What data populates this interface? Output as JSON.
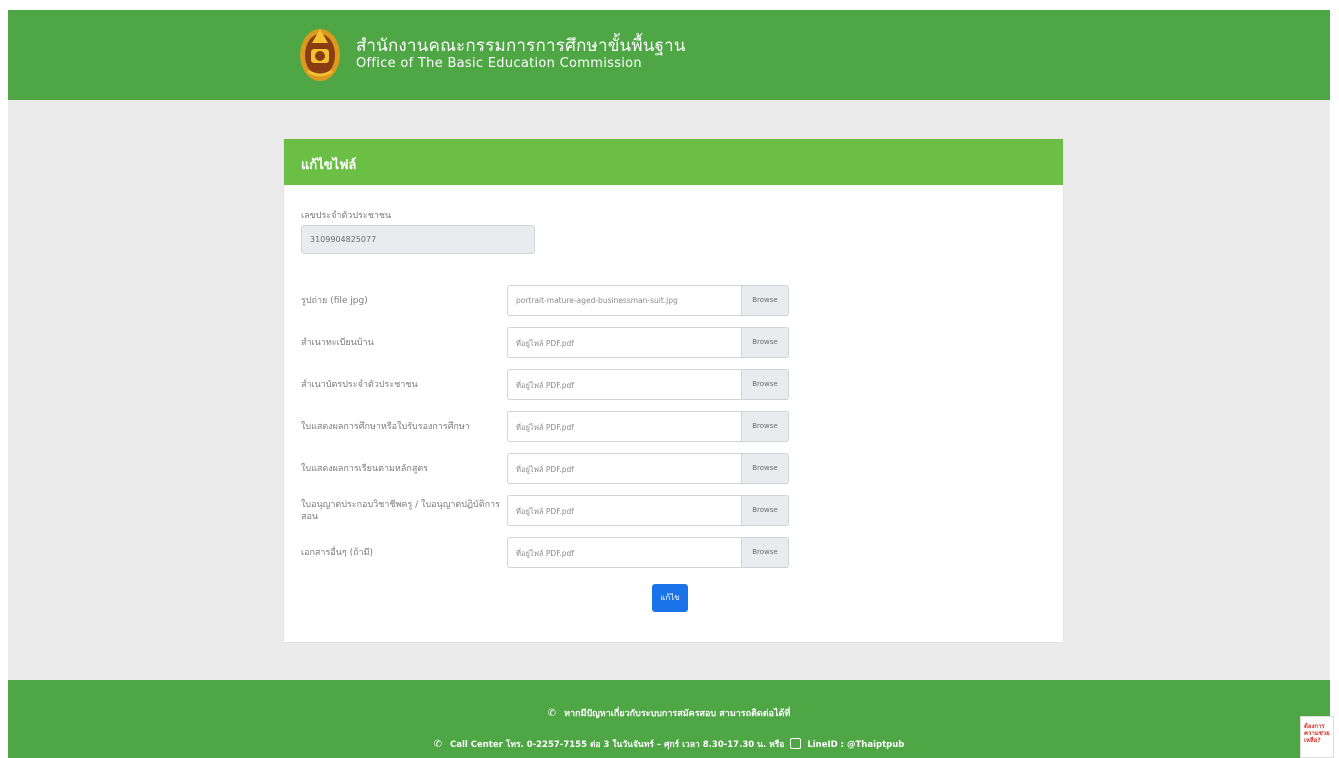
{
  "header": {
    "org_name_th": "สำนักงานคณะกรรมการการศึกษาขั้นพื้นฐาน",
    "org_name_en": "Office of The Basic Education Commission"
  },
  "form": {
    "title": "แก้ไขไฟล์",
    "id_label": "เลขประจำตัวประชาชน",
    "id_value": "3109904825077",
    "browse_label": "Browse",
    "rows": [
      {
        "label": "รูปถ่าย (file jpg)",
        "value": "portrait-mature-aged-businessman-suit.jpg"
      },
      {
        "label": "สำเนาทะเบียนบ้าน",
        "value": "ที่อยู่ไฟล์ PDF.pdf"
      },
      {
        "label": "สำเนาบัตรประจำตัวประชาชน",
        "value": "ที่อยู่ไฟล์ PDF.pdf"
      },
      {
        "label": "ใบแสดงผลการศึกษาหรือใบรับรองการศึกษา",
        "value": "ที่อยู่ไฟล์ PDF.pdf"
      },
      {
        "label": "ใบแสดงผลการเรียนตามหลักสูตร",
        "value": "ที่อยู่ไฟล์ PDF.pdf"
      },
      {
        "label": "ใบอนุญาตประกอบวิชาชีพครู / ใบอนุญาตปฏิบัติการสอน",
        "value": "ที่อยู่ไฟล์ PDF.pdf"
      },
      {
        "label": "เอกสารอื่นๆ (ถ้ามี)",
        "value": "ที่อยู่ไฟล์ PDF.pdf"
      }
    ],
    "submit_label": "แก้ไข"
  },
  "footer": {
    "line1": "หากมีปัญหาเกี่ยวกับระบบการสมัครสอบ สามารถติดต่อได้ที่",
    "line2_prefix": "Call Center โทร. 0-2257-7155 ต่อ 3 ในวันจันทร์ – ศุกร์ เวลา 8.30-17.30 น. หรือ",
    "line2_suffix": "LineID : @Thaiptpub"
  },
  "side_badge": {
    "text": "ต้องการ ความช่วยเหลือ?"
  }
}
